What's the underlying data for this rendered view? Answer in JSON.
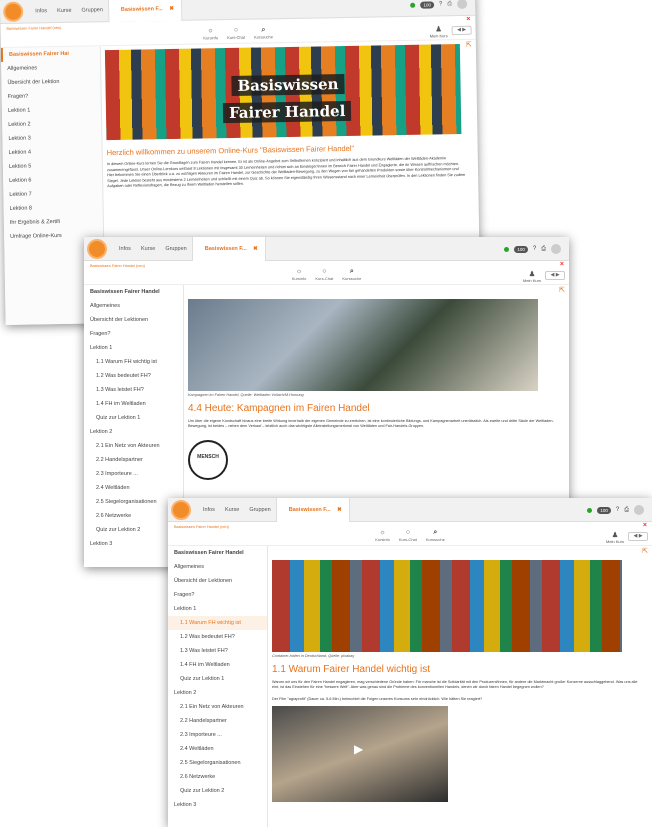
{
  "topnav": {
    "infos": "Infos",
    "kurse": "Kurse",
    "gruppen": "Gruppen",
    "tab1": "Basiswissen F...",
    "pill": "100"
  },
  "toolbar": {
    "kursinfo": "Kursinfo",
    "kurschat": "Kurs-Chat",
    "kurssuche": "Kurssuche",
    "meinkurs": "Mein Kurs",
    "breadcrumb": "Basiswissen Fairer Handel (neu)"
  },
  "w1": {
    "side": [
      "Basiswissen Fairer Hai",
      "Allgemeines",
      "Übersicht der Lektion",
      "Fragen?",
      "Lektion 1",
      "Lektion 2",
      "Lektion 3",
      "Lektion 4",
      "Lektion 5",
      "Lektion 6",
      "Lektion 7",
      "Lektion 8",
      "Ihr Ergebnis & Zertifi",
      "Umfrage Online-Kurs"
    ],
    "banner1": "Basiswissen",
    "banner2": "Fairer Handel",
    "heading": "Herzlich willkommen zu unserem Online-Kurs \"Basiswissen Fairer Handel\"",
    "text": "In diesem Online-Kurs lernen Sie die Grundlagen zum Fairen Handel kennen. Er ist als Online-Angebot zum Selbstlernen konzipiert und inhaltlich aus dem Grundkurs Weltläden der Weltläden-Akademie zusammengefasst. Unser Online-Lernkurs umfasst 8 Lektionen mit insgesamt 30 Lerneinheiten und richtet sich an Einsteiger/innen im Bereich Fairer Handel und Engagierte, die ihr Wissen auffrischen möchten. Hier bekommen Sie einen Überblick u.a. zu wichtigen Akteuren im Fairen Handel, zur Geschichte der Weltladen-Bewegung, zu den Wegen von fair gehandelten Produkten sowie über Kontrollmechanismen und Siegel. Jede Lektion besteht aus mindestens 2 Lerneinheiten und schließt mit einem Quiz ab. So können Sie eigenständig Ihren Wissensstand nach einer Lerneinheit überprüfen. In den Lektionen finden Sie zudem Aufgaben oder Reflexionsfragen, die Bezug zu Ihrem Weltladen herstellen sollen."
  },
  "w2": {
    "side": [
      "Basiswissen Fairer Handel",
      "Allgemeines",
      "Übersicht der Lektionen",
      "Fragen?",
      "Lektion 1",
      "1.1 Warum FH wichtig ist",
      "1.2 Was bedeutet FH?",
      "1.3 Was leistet FH?",
      "1.4 FH im Weltladen",
      "Quiz zur Lektion 1",
      "Lektion 2",
      "2.1 Ein Netz von Akteuren",
      "2.2 Handelspartner",
      "2.3 Importeure ...",
      "2.4 Weltläden",
      "2.5 Siegelorganisationen",
      "2.6 Netzwerke",
      "Quiz zur Lektion 2",
      "Lektion 3"
    ],
    "caption": "Kampagnen im Fairen Handel, Quelle: Weltladen Vollach/M.Hornung",
    "heading": "4.4 Heute: Kampagnen im Fairen Handel",
    "text": "Um über die eigene Kundschaft hinaus eine breite Wirkung innerhalb der eigenen Gemeinde zu erreichen, ist eine kontinuierliche Bildungs- und Kampagnenarbeit unerlässlich. Als zweite und dritte Säule der Weltladen-Bewegung, ist beides – neben dem Verkauf – letztlich auch das wichtigste Alleinstellungsmerkmal von Weltläden und Fair-Handels-Gruppen.",
    "stamp": "MENSCH"
  },
  "w3": {
    "side": [
      "Basiswissen Fairer Handel",
      "Allgemeines",
      "Übersicht der Lektionen",
      "Fragen?",
      "Lektion 1",
      "1.1 Warum FH wichtig ist",
      "1.2 Was bedeutet FH?",
      "1.3 Was leistet FH?",
      "1.4 FH im Weltladen",
      "Quiz zur Lektion 1",
      "Lektion 2",
      "2.1 Ein Netz von Akteuren",
      "2.2 Handelspartner",
      "2.3 Importeure ...",
      "2.4 Weltläden",
      "2.5 Siegelorganisationen",
      "2.6 Netzwerke",
      "Quiz zur Lektion 2",
      "Lektion 3"
    ],
    "caption": "Container-Hafen in Deutschland, Quelle: pixabay",
    "heading": "1.1 Warum Fairer Handel wichtig ist",
    "text": "Warum wir uns für den Fairen Handel engagieren, mag verschiedene Gründe haben: Für manche ist die Solidarität mit den Produzent/innen, für andere die Marktmacht großer Konzerne ausschlaggebend. Was uns alle eint, ist das Einstehen für eine \"bessere Welt\". Aber was genau sind die Probleme des konventionellen Handels, denen wir durch fairen Handel begegnen wollen?",
    "text2": "Der Film \"agraprofit\" (Dauer ca. 5-6 Min.) beleuchtet die Folgen unseres Konsums sehr eindrücklich. Wie hätten Sie reagiert?"
  }
}
